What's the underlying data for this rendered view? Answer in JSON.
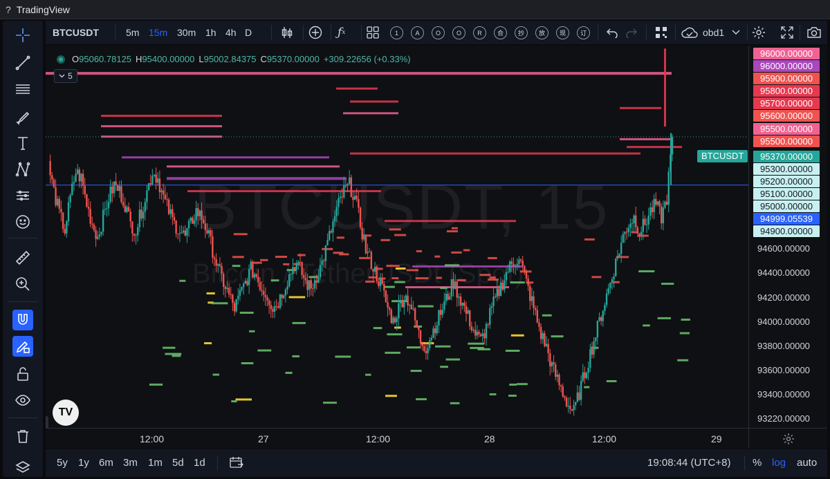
{
  "window": {
    "title": "TradingView",
    "help_glyph": "?"
  },
  "toolbar": {
    "symbol": "BTCUSDT",
    "intervals": [
      "5m",
      "15m",
      "30m",
      "1h",
      "4h",
      "D"
    ],
    "active_interval": "15m",
    "indicator_circles": [
      "1",
      "A",
      "O",
      "O",
      "R",
      "合",
      "抄",
      "放",
      "现",
      "订"
    ],
    "layout_name": "obd1"
  },
  "legend": {
    "open_label": "O",
    "open": "95060.78125",
    "high_label": "H",
    "high": "95400.00000",
    "low_label": "L",
    "low": "95002.84375",
    "close_label": "C",
    "close": "95370.00000",
    "change": "+309.22656 (+0.33%)",
    "collapsed_count": "5"
  },
  "watermark": {
    "symbol": "BTCUSDT, 15",
    "description": "Bitcoin / TetherUSDt (Spot)"
  },
  "symbol_tag": "BTCUSDT",
  "price_axis": {
    "labels": [
      {
        "text": "96000.00000",
        "bg": "#f06292"
      },
      {
        "text": "96000.00000",
        "bg": "#ab47bc"
      },
      {
        "text": "95900.00000",
        "bg": "#ef5350"
      },
      {
        "text": "95800.00000",
        "bg": "#e53950"
      },
      {
        "text": "95700.00000",
        "bg": "#e53950"
      },
      {
        "text": "95600.00000",
        "bg": "#ef5350"
      },
      {
        "text": "95500.00000",
        "bg": "#f06292"
      },
      {
        "text": "95500.00000",
        "bg": "#ef5350"
      },
      {
        "text": "95370.00000",
        "bg": "#26a69a"
      },
      {
        "text": "95300.00000",
        "bg": "#c8f0f0"
      },
      {
        "text": "95200.00000",
        "bg": "#c8f0f0"
      },
      {
        "text": "95100.00000",
        "bg": "#c8f0f0"
      },
      {
        "text": "95000.00000",
        "bg": "#c8f0f0"
      },
      {
        "text": "94999.05539",
        "bg": "#2962ff"
      },
      {
        "text": "94900.00000",
        "bg": "#c8f0f0"
      }
    ],
    "plain_labels": [
      "94600.00000",
      "94400.00000",
      "94200.00000",
      "94000.00000",
      "93800.00000",
      "93600.00000",
      "93400.00000",
      "93220.00000"
    ]
  },
  "time_axis": [
    "12:00",
    "27",
    "12:00",
    "28",
    "12:00",
    "29"
  ],
  "bottom_bar": {
    "ranges": [
      "5y",
      "1y",
      "6m",
      "3m",
      "1m",
      "5d",
      "1d"
    ],
    "clock": "19:08:44 (UTC+8)",
    "percent": "%",
    "log": "log",
    "auto": "auto"
  },
  "colors": {
    "up": "#26a69a",
    "down": "#ef5350",
    "accent": "#2962ff",
    "wall_pink": "#f06292",
    "wall_purple": "#ab47bc",
    "wall_red": "#e53950",
    "wall_green": "#66bb6a",
    "wall_yellow": "#fdd835"
  },
  "chart_data": {
    "type": "candlestick",
    "symbol": "BTCUSDT",
    "interval": "15m",
    "ylim": [
      93150,
      96050
    ],
    "x_labels": [
      "12:00",
      "27",
      "12:00",
      "28",
      "12:00",
      "29"
    ],
    "last_price": 95370,
    "candles_close": [
      95150,
      94950,
      94780,
      94650,
      94900,
      95100,
      95050,
      94850,
      94700,
      94600,
      94750,
      94900,
      95000,
      94950,
      94850,
      94700,
      94650,
      94800,
      94950,
      95100,
      95050,
      94900,
      94800,
      94700,
      94650,
      94600,
      94700,
      94800,
      94750,
      94650,
      94500,
      94350,
      94250,
      94150,
      94050,
      94150,
      94250,
      94350,
      94300,
      94200,
      94150,
      94050,
      94100,
      94200,
      94300,
      94400,
      94350,
      94250,
      94200,
      94300,
      94400,
      94550,
      94700,
      94850,
      94950,
      95000,
      94900,
      94700,
      94500,
      94400,
      94300,
      94200,
      94050,
      93950,
      94050,
      94150,
      94100,
      93950,
      93800,
      93750,
      93850,
      93950,
      94050,
      94150,
      94250,
      94150,
      94050,
      93950,
      93850,
      93800,
      93900,
      94050,
      94150,
      94250,
      94350,
      94400,
      94450,
      94300,
      94150,
      94000,
      93850,
      93750,
      93600,
      93500,
      93400,
      93300,
      93250,
      93400,
      93550,
      93700,
      93850,
      94000,
      94150,
      94300,
      94450,
      94600,
      94700,
      94750,
      94650,
      94700,
      94800,
      94850,
      94750,
      94900,
      95370
    ]
  }
}
